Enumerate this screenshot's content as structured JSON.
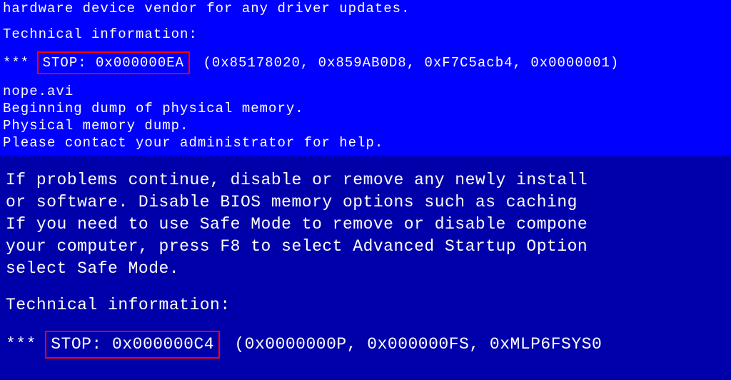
{
  "top": {
    "line1": "hardware device vendor for any driver updates.",
    "tech_header": "Technical information:",
    "stop_prefix": "*** ",
    "stop_code": "STOP: 0x000000EA",
    "stop_params": " (0x85178020, 0x859AB0D8, 0xF7C5acb4, 0x0000001)",
    "file": "nope.avi",
    "dump1": "Beginning dump of physical memory.",
    "dump2": "Physical memory dump.",
    "dump3": "Please contact your administrator for help."
  },
  "bottom": {
    "line1": "If problems continue, disable or remove any newly install",
    "line2": "or software. Disable BIOS memory options such as caching ",
    "line3": "If you need to use Safe Mode to remove or disable compone",
    "line4": "your computer, press F8 to select Advanced Startup Option",
    "line5": "select Safe Mode.",
    "tech_header": "Technical information:",
    "stop_prefix": "*** ",
    "stop_code": "STOP: 0x000000C4",
    "stop_params": " (0x0000000P, 0x000000FS, 0xMLP6FSYS0"
  }
}
